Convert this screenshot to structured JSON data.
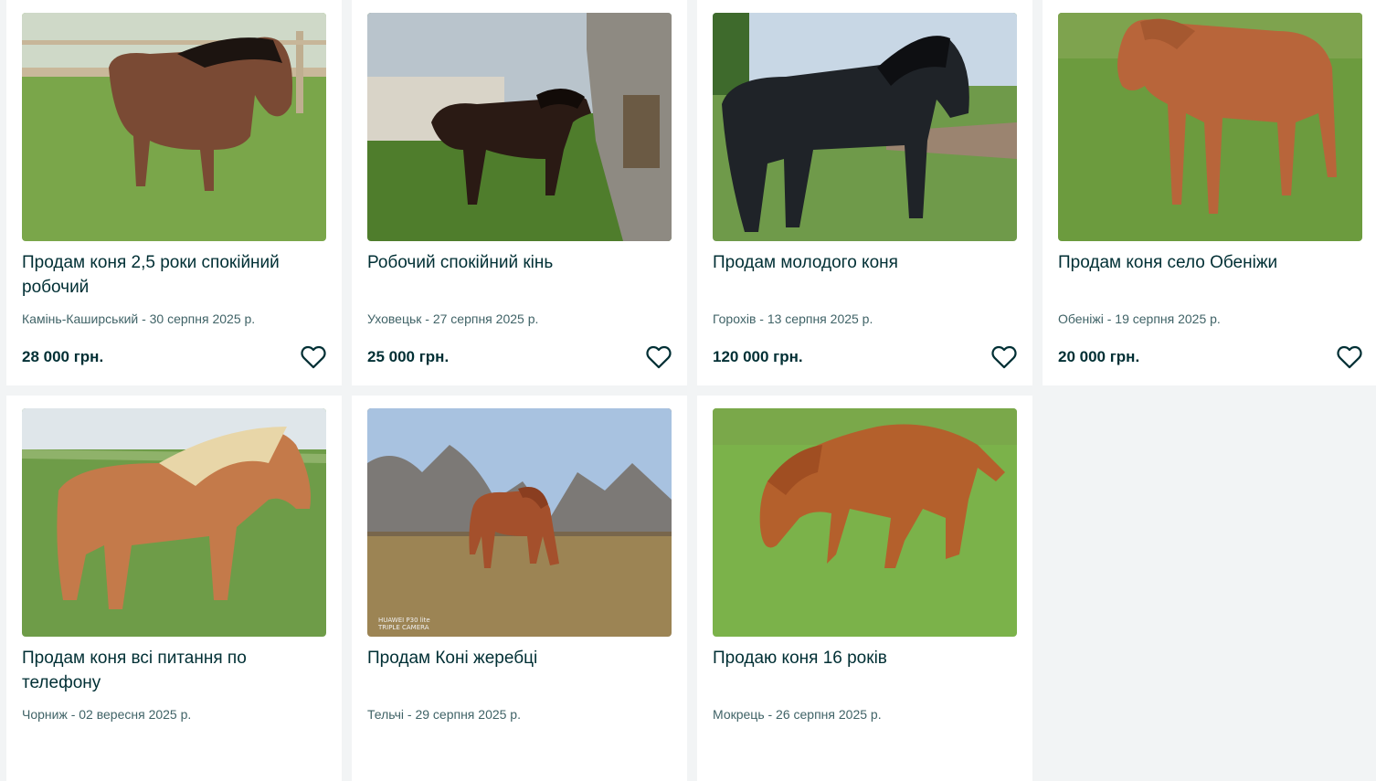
{
  "listings": [
    {
      "title": "Продам коня 2,5 роки спокійний робочий",
      "meta": "Камінь-Каширський - 30 серпня 2025 р.",
      "price": "28 000 грн.",
      "photo": {
        "sky": "#cfd9c8",
        "ground": "#7aa64a",
        "horse": "#7a4a34",
        "mane": "#1c1410"
      }
    },
    {
      "title": "Робочий спокійний кінь",
      "meta": "Уховецьк - 27 серпня 2025 р.",
      "price": "25 000 грн.",
      "photo": {
        "sky": "#b9c4cc",
        "ground": "#4f7d2c",
        "horse": "#2a1a14",
        "mane": "#120b08"
      }
    },
    {
      "title": "Продам молодого коня",
      "meta": "Горохів - 13 серпня 2025 р.",
      "price": "120 000 грн.",
      "photo": {
        "sky": "#c8d7e5",
        "ground": "#6f9a4a",
        "horse": "#1f2328",
        "mane": "#0e0f12"
      }
    },
    {
      "title": "Продам коня село Обеніжи",
      "meta": "Обеніжі - 19 серпня 2025 р.",
      "price": "20 000 грн.",
      "photo": {
        "sky": "#7ea34e",
        "ground": "#6c9b3e",
        "horse": "#b8653a",
        "mane": "#a55830"
      }
    },
    {
      "title": "Продам коня всі питання по телефону",
      "meta": "Чорниж - 02 вересня 2025 р.",
      "price": "",
      "photo": {
        "sky": "#dfe6ea",
        "ground": "#6e9c48",
        "horse": "#c47a4a",
        "mane": "#e8d6a8"
      }
    },
    {
      "title": "Продам Коні жеребці",
      "meta": "Тельчі - 29 серпня 2025 р.",
      "price": "",
      "photo": {
        "sky": "#a8c2e0",
        "ground": "#9c8454",
        "horse": "#a4502c",
        "mane": "#8a3e20"
      },
      "watermark": "HUAWEI P30 lite\nTRIPLE CAMERA"
    },
    {
      "title": "Продаю коня 16 років",
      "meta": "Мокрець - 26 серпня 2025 р.",
      "price": "",
      "photo": {
        "sky": "#7aa84a",
        "ground": "#7bb24a",
        "horse": "#b4602c",
        "mane": "#a04e22"
      }
    }
  ],
  "colors": {
    "page_bg": "#f2f4f5",
    "card_bg": "#ffffff",
    "text_primary": "#002f34",
    "text_secondary": "#406367"
  },
  "icons": {
    "favorite": "heart-outline-icon"
  }
}
